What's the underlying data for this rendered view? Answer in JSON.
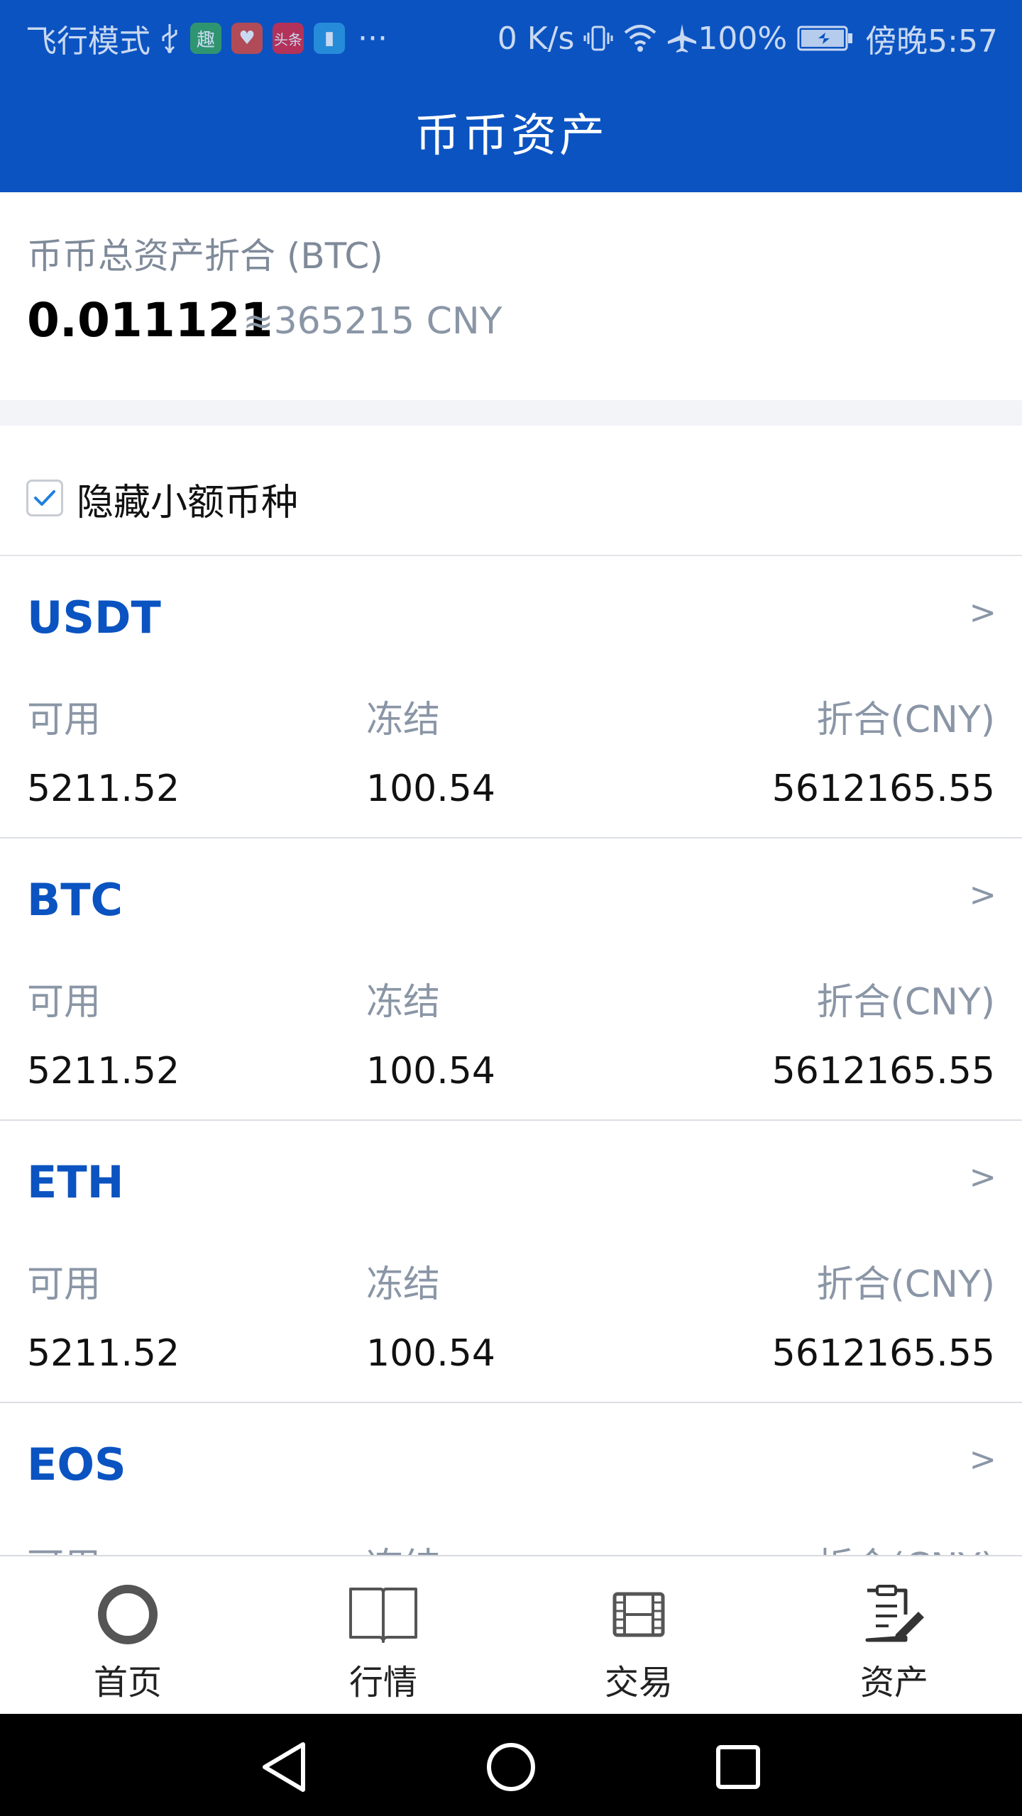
{
  "status_bar": {
    "carrier": "飞行模式",
    "apps": [
      {
        "icon": "qu-app-icon",
        "text": "趣",
        "color": "#3aa85a"
      },
      {
        "icon": "health-app-icon",
        "text": "♥",
        "color": "#e04a3a"
      },
      {
        "icon": "toutiao-app-icon",
        "text": "头条",
        "color": "#e3293c"
      },
      {
        "icon": "reader-app-icon",
        "text": "▮",
        "color": "#2e9be0"
      }
    ],
    "more": "···",
    "speed": "0 K/s",
    "battery": "100%",
    "time": "傍晚5:57"
  },
  "header": {
    "title": "币币资产"
  },
  "summary": {
    "label": "币币总资产折合 (BTC)",
    "btc_value": "0.011121",
    "cny_value": "≈365215 CNY"
  },
  "hide_small": {
    "label": "隐藏小额币种",
    "checked": true
  },
  "columns": {
    "available": "可用",
    "frozen": "冻结",
    "converted": "折合(CNY)"
  },
  "coins": [
    {
      "name": "USDT",
      "available": "5211.52",
      "frozen": "100.54",
      "converted": "5612165.55"
    },
    {
      "name": "BTC",
      "available": "5211.52",
      "frozen": "100.54",
      "converted": "5612165.55"
    },
    {
      "name": "ETH",
      "available": "5211.52",
      "frozen": "100.54",
      "converted": "5612165.55"
    },
    {
      "name": "EOS",
      "available": "",
      "frozen": "",
      "converted": ""
    }
  ],
  "arrow": ">",
  "tabs": [
    {
      "label": "首页",
      "icon": "home-circle-icon"
    },
    {
      "label": "行情",
      "icon": "book-icon"
    },
    {
      "label": "交易",
      "icon": "film-icon"
    },
    {
      "label": "资产",
      "icon": "clipboard-edit-icon"
    }
  ],
  "colors": {
    "brand": "#0b53c1",
    "muted": "#8a96a6",
    "divider": "#dcdfe4"
  }
}
